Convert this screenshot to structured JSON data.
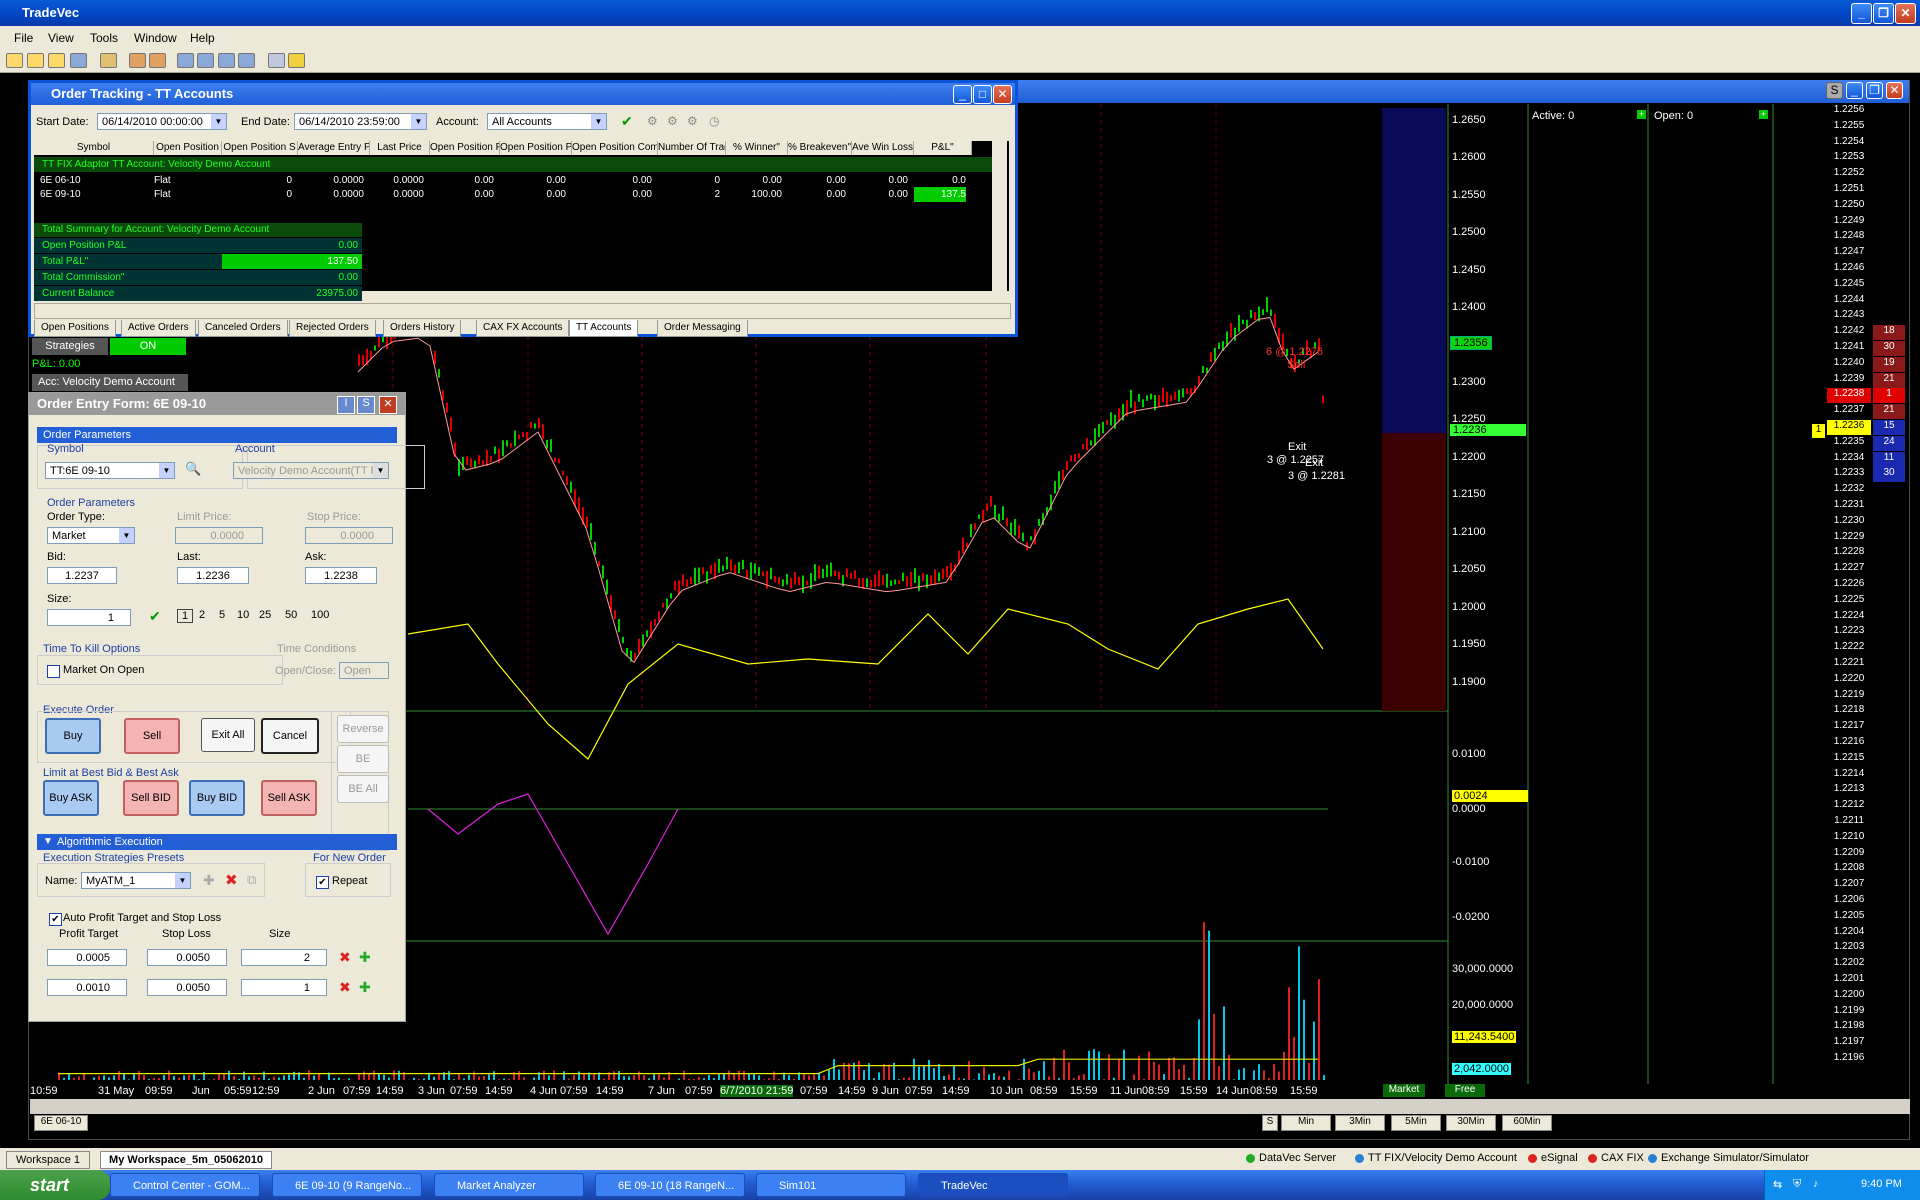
{
  "app": {
    "title": "TradeVec"
  },
  "menu": [
    "File",
    "View",
    "Tools",
    "Window",
    "Help"
  ],
  "order_tracking": {
    "title": "Order Tracking - TT Accounts",
    "start_label": "Start Date:",
    "start_value": "06/14/2010 00:00:00",
    "end_label": "End Date:",
    "end_value": "06/14/2010 23:59:00",
    "account_label": "Account:",
    "account_value": "All Accounts",
    "columns": [
      "Symbol",
      "Open Position",
      "Open Position S",
      "Average Entry Pr",
      "Last Price",
      "Open Position P",
      "Open Position P&",
      "Open Position Commis",
      "Number Of Trade",
      "% Winner\"",
      "% Breakeven\"",
      "Ave Win Loss\"",
      "P&L\""
    ],
    "group_row": "TT FIX Adaptor   TT   Account: Velocity Demo Account",
    "rows": [
      [
        "6E 06-10",
        "Flat",
        "0",
        "0.0000",
        "0.0000",
        "0.00",
        "0.00",
        "0.00",
        "0",
        "0.00",
        "0.00",
        "0.00",
        "0.0"
      ],
      [
        "6E 09-10",
        "Flat",
        "0",
        "0.0000",
        "0.0000",
        "0.00",
        "0.00",
        "0.00",
        "2",
        "100.00",
        "0.00",
        "0.00",
        "137.5"
      ]
    ],
    "summary_title": "Total Summary for Account: Velocity Demo Account",
    "summary": [
      {
        "label": "Open Position P&L",
        "value": "0.00"
      },
      {
        "label": "Total P&L\"",
        "value": "137.50"
      },
      {
        "label": "Total Commission\"",
        "value": "0.00"
      },
      {
        "label": "Current Balance",
        "value": "23975.00"
      }
    ],
    "tabs": [
      "Open Positions",
      "Active Orders",
      "Canceled Orders",
      "Rejected Orders",
      "Orders History",
      "CAX FX Accounts",
      "TT Accounts",
      "Order Messaging"
    ]
  },
  "strategies": {
    "label": "Strategies",
    "state": "ON",
    "pnl": "P&L: 0.00",
    "account": "Acc: Velocity Demo Account"
  },
  "order_entry": {
    "title": "Order Entry Form: 6E 09-10",
    "order_parameters": "Order Parameters",
    "symbol_label": "Symbol",
    "symbol_value": "TT:6E 09-10",
    "account_label": "Account",
    "account_value": "Velocity Demo Account(TT F",
    "params_label": "Order Parameters",
    "order_type_label": "Order Type:",
    "order_type_value": "Market",
    "limit_label": "Limit Price:",
    "limit_value": "0.0000",
    "stop_label": "Stop Price:",
    "stop_value": "0.0000",
    "bid_label": "Bid:",
    "bid_value": "1.2237",
    "last_label": "Last:",
    "last_value": "1.2236",
    "ask_label": "Ask:",
    "ask_value": "1.2238",
    "size_label": "Size:",
    "size_value": "1",
    "quick_sizes": [
      "1",
      "2",
      "5",
      "10",
      "25",
      "50",
      "100"
    ],
    "ttk_label": "Time To Kill Options",
    "moo_label": "Market On Open",
    "tc_label": "Time Conditions",
    "oc_label": "Open/Close:",
    "oc_value": "Open",
    "execute_label": "Execute Order",
    "buy": "Buy",
    "sell": "Sell",
    "exit_all": "Exit All",
    "cancel": "Cancel",
    "reverse": "Reverse",
    "be": "BE",
    "be_all": "BE All",
    "limit_best_label": "Limit at Best Bid & Best Ask",
    "buy_ask": "Buy ASK",
    "sell_bid": "Sell BID",
    "buy_bid": "Buy BID",
    "sell_ask": "Sell ASK",
    "algo_label": "Algorithmic Execution",
    "presets_label": "Execution Strategies Presets",
    "name_label": "Name:",
    "name_value": "MyATM_1",
    "new_order_label": "For New Order",
    "repeat_label": "Repeat",
    "auto_label": "Auto Profit Target and Stop Loss",
    "pt_label": "Profit Target",
    "sl_label": "Stop Loss",
    "sz_label": "Size",
    "brackets": [
      [
        "0.0005",
        "0.0050",
        "2"
      ],
      [
        "0.0010",
        "0.0050",
        "1"
      ]
    ]
  },
  "chart": {
    "price_axis": [
      "1.2650",
      "1.2600",
      "1.2550",
      "1.2500",
      "1.2450",
      "1.2400",
      "1.2350",
      "1.2300",
      "1.2250",
      "1.2200",
      "1.2150",
      "1.2100",
      "1.2050",
      "1.2000",
      "1.1950",
      "1.1900"
    ],
    "price_marker_1": "1.2356",
    "price_marker_2": "1.2236",
    "osc_axis": [
      "0.0100",
      "0.0024",
      "0.0000",
      "-0.0100",
      "-0.0200"
    ],
    "vol_axis": [
      "30,000.0000",
      "20,000.0000",
      "11,243.5400",
      "2,042.0000"
    ],
    "annotations": [
      "6 @ 1.2276",
      "Sell",
      "Exit",
      "3 @ 1.2257",
      "Exit",
      "3 @ 1.2281"
    ],
    "time_axis": [
      "10:59",
      "31 May",
      "09:59",
      "Jun",
      "05:59",
      "12:59",
      "2 Jun",
      "07:59",
      "14:59",
      "3 Jun",
      "07:59",
      "14:59",
      "4 Jun",
      "07:59",
      "14:59",
      "7 Jun",
      "07:59",
      "6/7/2010 21:59",
      "07:59",
      "14:59",
      "9 Jun",
      "07:59",
      "14:59",
      "10 Jun",
      "08:59",
      "15:59",
      "11 Jun",
      "08:59",
      "15:59",
      "14 Jun",
      "08:59",
      "15:59"
    ],
    "active_label": "Active: 0",
    "open_label": "Open: 0",
    "market_free": [
      "Market",
      "Free"
    ],
    "intervals": [
      "Min",
      "3Min",
      "5Min",
      "30Min",
      "60Min"
    ],
    "symbol_tab": "6E 06-10",
    "ladder": [
      [
        "1.2256",
        ""
      ],
      [
        "1.2255",
        ""
      ],
      [
        "1.2254",
        ""
      ],
      [
        "1.2253",
        ""
      ],
      [
        "1.2252",
        ""
      ],
      [
        "1.2251",
        ""
      ],
      [
        "1.2250",
        ""
      ],
      [
        "1.2249",
        ""
      ],
      [
        "1.2248",
        ""
      ],
      [
        "1.2247",
        ""
      ],
      [
        "1.2246",
        ""
      ],
      [
        "1.2245",
        ""
      ],
      [
        "1.2244",
        ""
      ],
      [
        "1.2243",
        ""
      ],
      [
        "1.2242",
        "18"
      ],
      [
        "1.2241",
        "30"
      ],
      [
        "1.2240",
        "19"
      ],
      [
        "1.2239",
        "21"
      ],
      [
        "1.2238",
        "1"
      ],
      [
        "1.2237",
        "21"
      ],
      [
        "1.2236",
        "15"
      ],
      [
        "1.2235",
        "24"
      ],
      [
        "1.2234",
        "11"
      ],
      [
        "1.2233",
        "30"
      ],
      [
        "1.2232",
        ""
      ],
      [
        "1.2231",
        ""
      ],
      [
        "1.2230",
        ""
      ],
      [
        "1.2229",
        ""
      ],
      [
        "1.2228",
        ""
      ],
      [
        "1.2227",
        ""
      ],
      [
        "1.2226",
        ""
      ],
      [
        "1.2225",
        ""
      ],
      [
        "1.2224",
        ""
      ],
      [
        "1.2223",
        ""
      ],
      [
        "1.2222",
        ""
      ],
      [
        "1.2221",
        ""
      ],
      [
        "1.2220",
        ""
      ],
      [
        "1.2219",
        ""
      ],
      [
        "1.2218",
        ""
      ],
      [
        "1.2217",
        ""
      ],
      [
        "1.2216",
        ""
      ],
      [
        "1.2215",
        ""
      ],
      [
        "1.2214",
        ""
      ],
      [
        "1.2213",
        ""
      ],
      [
        "1.2212",
        ""
      ],
      [
        "1.2211",
        ""
      ],
      [
        "1.2210",
        ""
      ],
      [
        "1.2209",
        ""
      ],
      [
        "1.2208",
        ""
      ],
      [
        "1.2207",
        ""
      ],
      [
        "1.2206",
        ""
      ],
      [
        "1.2205",
        ""
      ],
      [
        "1.2204",
        ""
      ],
      [
        "1.2203",
        ""
      ],
      [
        "1.2202",
        ""
      ],
      [
        "1.2201",
        ""
      ],
      [
        "1.2200",
        ""
      ],
      [
        "1.2199",
        ""
      ],
      [
        "1.2198",
        ""
      ],
      [
        "1.2197",
        ""
      ],
      [
        "1.2196",
        ""
      ]
    ],
    "ladder_pos": "1"
  },
  "workspaces": [
    "Workspace 1",
    "My Workspace_5m_05062010"
  ],
  "status_bar": [
    "DataVec Server",
    "TT FIX/Velocity Demo Account",
    "eSignal",
    "CAX FIX",
    "Exchange Simulator/Simulator"
  ],
  "taskbar": {
    "start": "start",
    "tasks": [
      "Control Center - GOM...",
      "6E 09-10 (9 RangeNo...",
      "Market Analyzer",
      "6E 09-10 (18 RangeN...",
      "Sim101",
      "TradeVec"
    ],
    "clock": "9:40 PM"
  },
  "colors": {
    "accent": "#0a53d8",
    "up": "#00c800",
    "down": "#e00000",
    "osc_pos": "#ffff00",
    "osc_neg": "#e020e0"
  }
}
